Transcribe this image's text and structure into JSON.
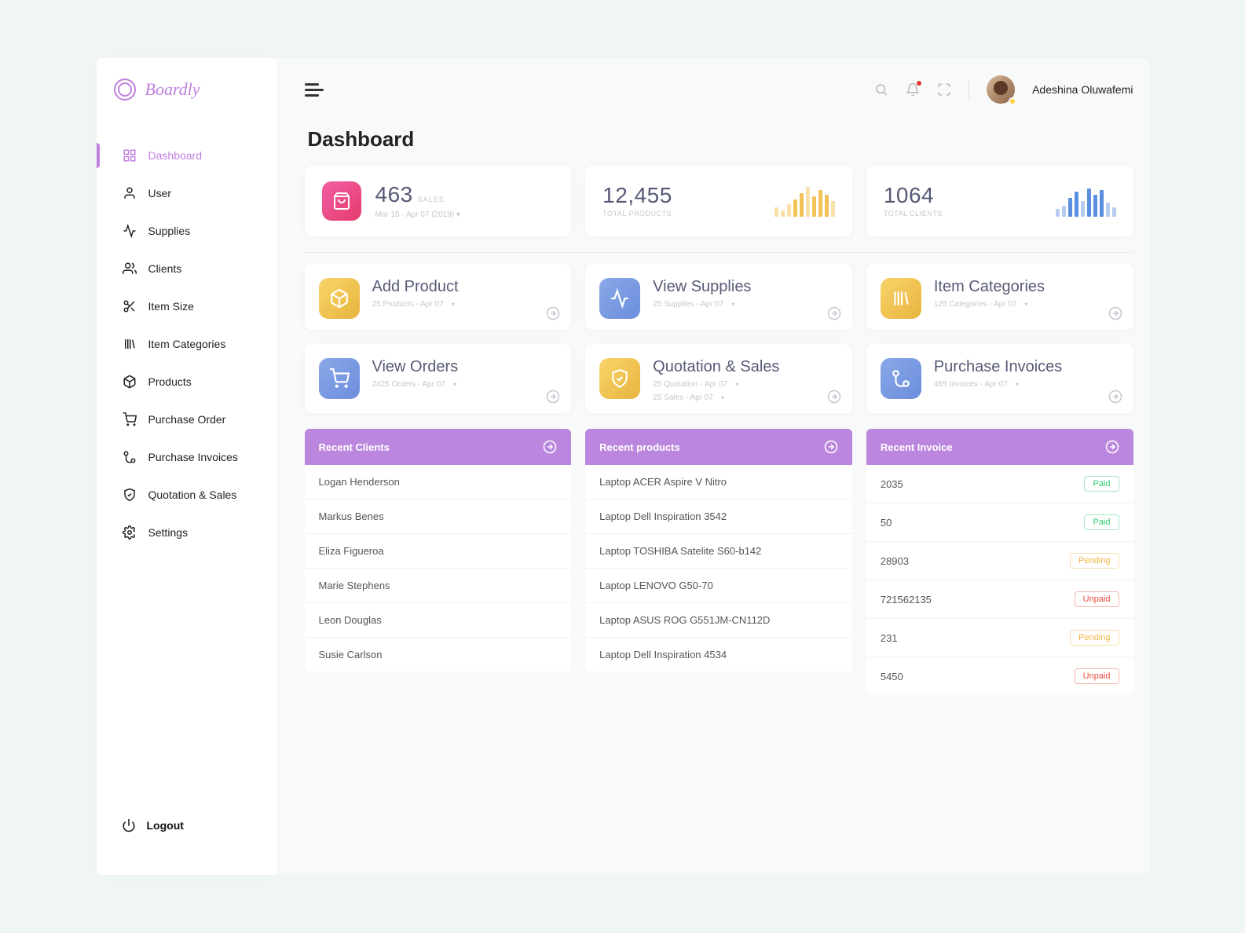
{
  "brand": "Boardly",
  "user": {
    "name": "Adeshina Oluwafemi"
  },
  "sidebar": {
    "items": [
      {
        "label": "Dashboard",
        "icon": "grid",
        "active": true
      },
      {
        "label": "User",
        "icon": "user"
      },
      {
        "label": "Supplies",
        "icon": "activity"
      },
      {
        "label": "Clients",
        "icon": "users"
      },
      {
        "label": "Item Size",
        "icon": "scissors"
      },
      {
        "label": "Item Categories",
        "icon": "books"
      },
      {
        "label": "Products",
        "icon": "box"
      },
      {
        "label": "Purchase Order",
        "icon": "cart"
      },
      {
        "label": "Purchase Invoices",
        "icon": "branch"
      },
      {
        "label": "Quotation & Sales",
        "icon": "shield"
      },
      {
        "label": "Settings",
        "icon": "gear"
      }
    ],
    "logout": "Logout"
  },
  "page": {
    "title": "Dashboard"
  },
  "stats": {
    "sales": {
      "value": "463",
      "label": "SALES",
      "range": "Mar 15 - Apr 07 (2019)"
    },
    "products": {
      "value": "12,455",
      "label": "TOTAL PRODUCTS"
    },
    "clients": {
      "value": "1064",
      "label": "TOTAL CLIENTS"
    }
  },
  "quick": [
    {
      "title": "Add Product",
      "sub": "25 Products - Apr 07",
      "icon": "box",
      "grad": "yellow"
    },
    {
      "title": "View Supplies",
      "sub": "25 Supplies - Apr 07",
      "icon": "activity",
      "grad": "blue"
    },
    {
      "title": "Item Categories",
      "sub": "125 Categories - Apr 07",
      "icon": "books",
      "grad": "yellow"
    },
    {
      "title": "View Orders",
      "sub": "2425 Orders - Apr 07",
      "icon": "cart",
      "grad": "blue"
    },
    {
      "title": "Quotation & Sales",
      "sub": "25 Quotation - Apr 07",
      "sub2": "25 Sales - Apr 07",
      "icon": "shield",
      "grad": "yellow"
    },
    {
      "title": "Purchase Invoices",
      "sub": "465 Invoices - Apr 07",
      "icon": "branch",
      "grad": "blue"
    }
  ],
  "recents": {
    "clients": {
      "title": "Recent Clients",
      "rows": [
        "Logan Henderson",
        "Markus Benes",
        "Eliza Figueroa",
        "Marie Stephens",
        "Leon Douglas",
        "Susie Carlson"
      ]
    },
    "products": {
      "title": "Recent products",
      "rows": [
        "Laptop ACER Aspire V Nitro",
        "Laptop Dell Inspiration 3542",
        "Laptop TOSHIBA Satelite S60-b142",
        "Laptop LENOVO G50-70",
        "Laptop ASUS ROG G551JM-CN112D",
        "Laptop Dell Inspiration 4534"
      ]
    },
    "invoices": {
      "title": "Recent Invoice",
      "rows": [
        {
          "id": "2035",
          "status": "Paid"
        },
        {
          "id": "50",
          "status": "Paid"
        },
        {
          "id": "28903",
          "status": "Pending"
        },
        {
          "id": "721562135",
          "status": "Unpaid"
        },
        {
          "id": "231",
          "status": "Pending"
        },
        {
          "id": "5450",
          "status": "Unpaid"
        }
      ]
    }
  }
}
